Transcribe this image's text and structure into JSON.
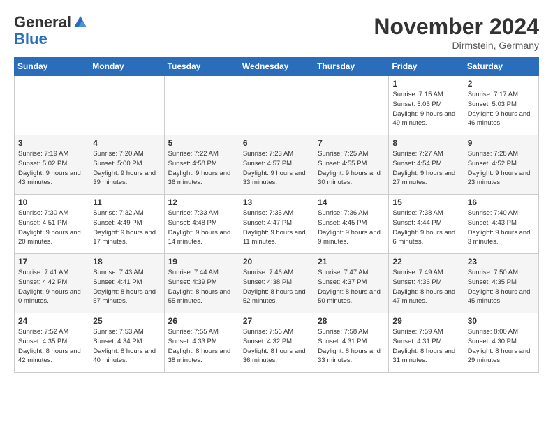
{
  "header": {
    "logo_general": "General",
    "logo_blue": "Blue",
    "month_title": "November 2024",
    "location": "Dirmstein, Germany"
  },
  "weekdays": [
    "Sunday",
    "Monday",
    "Tuesday",
    "Wednesday",
    "Thursday",
    "Friday",
    "Saturday"
  ],
  "weeks": [
    [
      {
        "day": "",
        "info": ""
      },
      {
        "day": "",
        "info": ""
      },
      {
        "day": "",
        "info": ""
      },
      {
        "day": "",
        "info": ""
      },
      {
        "day": "",
        "info": ""
      },
      {
        "day": "1",
        "info": "Sunrise: 7:15 AM\nSunset: 5:05 PM\nDaylight: 9 hours\nand 49 minutes."
      },
      {
        "day": "2",
        "info": "Sunrise: 7:17 AM\nSunset: 5:03 PM\nDaylight: 9 hours\nand 46 minutes."
      }
    ],
    [
      {
        "day": "3",
        "info": "Sunrise: 7:19 AM\nSunset: 5:02 PM\nDaylight: 9 hours\nand 43 minutes."
      },
      {
        "day": "4",
        "info": "Sunrise: 7:20 AM\nSunset: 5:00 PM\nDaylight: 9 hours\nand 39 minutes."
      },
      {
        "day": "5",
        "info": "Sunrise: 7:22 AM\nSunset: 4:58 PM\nDaylight: 9 hours\nand 36 minutes."
      },
      {
        "day": "6",
        "info": "Sunrise: 7:23 AM\nSunset: 4:57 PM\nDaylight: 9 hours\nand 33 minutes."
      },
      {
        "day": "7",
        "info": "Sunrise: 7:25 AM\nSunset: 4:55 PM\nDaylight: 9 hours\nand 30 minutes."
      },
      {
        "day": "8",
        "info": "Sunrise: 7:27 AM\nSunset: 4:54 PM\nDaylight: 9 hours\nand 27 minutes."
      },
      {
        "day": "9",
        "info": "Sunrise: 7:28 AM\nSunset: 4:52 PM\nDaylight: 9 hours\nand 23 minutes."
      }
    ],
    [
      {
        "day": "10",
        "info": "Sunrise: 7:30 AM\nSunset: 4:51 PM\nDaylight: 9 hours\nand 20 minutes."
      },
      {
        "day": "11",
        "info": "Sunrise: 7:32 AM\nSunset: 4:49 PM\nDaylight: 9 hours\nand 17 minutes."
      },
      {
        "day": "12",
        "info": "Sunrise: 7:33 AM\nSunset: 4:48 PM\nDaylight: 9 hours\nand 14 minutes."
      },
      {
        "day": "13",
        "info": "Sunrise: 7:35 AM\nSunset: 4:47 PM\nDaylight: 9 hours\nand 11 minutes."
      },
      {
        "day": "14",
        "info": "Sunrise: 7:36 AM\nSunset: 4:45 PM\nDaylight: 9 hours\nand 9 minutes."
      },
      {
        "day": "15",
        "info": "Sunrise: 7:38 AM\nSunset: 4:44 PM\nDaylight: 9 hours\nand 6 minutes."
      },
      {
        "day": "16",
        "info": "Sunrise: 7:40 AM\nSunset: 4:43 PM\nDaylight: 9 hours\nand 3 minutes."
      }
    ],
    [
      {
        "day": "17",
        "info": "Sunrise: 7:41 AM\nSunset: 4:42 PM\nDaylight: 9 hours\nand 0 minutes."
      },
      {
        "day": "18",
        "info": "Sunrise: 7:43 AM\nSunset: 4:41 PM\nDaylight: 8 hours\nand 57 minutes."
      },
      {
        "day": "19",
        "info": "Sunrise: 7:44 AM\nSunset: 4:39 PM\nDaylight: 8 hours\nand 55 minutes."
      },
      {
        "day": "20",
        "info": "Sunrise: 7:46 AM\nSunset: 4:38 PM\nDaylight: 8 hours\nand 52 minutes."
      },
      {
        "day": "21",
        "info": "Sunrise: 7:47 AM\nSunset: 4:37 PM\nDaylight: 8 hours\nand 50 minutes."
      },
      {
        "day": "22",
        "info": "Sunrise: 7:49 AM\nSunset: 4:36 PM\nDaylight: 8 hours\nand 47 minutes."
      },
      {
        "day": "23",
        "info": "Sunrise: 7:50 AM\nSunset: 4:35 PM\nDaylight: 8 hours\nand 45 minutes."
      }
    ],
    [
      {
        "day": "24",
        "info": "Sunrise: 7:52 AM\nSunset: 4:35 PM\nDaylight: 8 hours\nand 42 minutes."
      },
      {
        "day": "25",
        "info": "Sunrise: 7:53 AM\nSunset: 4:34 PM\nDaylight: 8 hours\nand 40 minutes."
      },
      {
        "day": "26",
        "info": "Sunrise: 7:55 AM\nSunset: 4:33 PM\nDaylight: 8 hours\nand 38 minutes."
      },
      {
        "day": "27",
        "info": "Sunrise: 7:56 AM\nSunset: 4:32 PM\nDaylight: 8 hours\nand 36 minutes."
      },
      {
        "day": "28",
        "info": "Sunrise: 7:58 AM\nSunset: 4:31 PM\nDaylight: 8 hours\nand 33 minutes."
      },
      {
        "day": "29",
        "info": "Sunrise: 7:59 AM\nSunset: 4:31 PM\nDaylight: 8 hours\nand 31 minutes."
      },
      {
        "day": "30",
        "info": "Sunrise: 8:00 AM\nSunset: 4:30 PM\nDaylight: 8 hours\nand 29 minutes."
      }
    ]
  ]
}
